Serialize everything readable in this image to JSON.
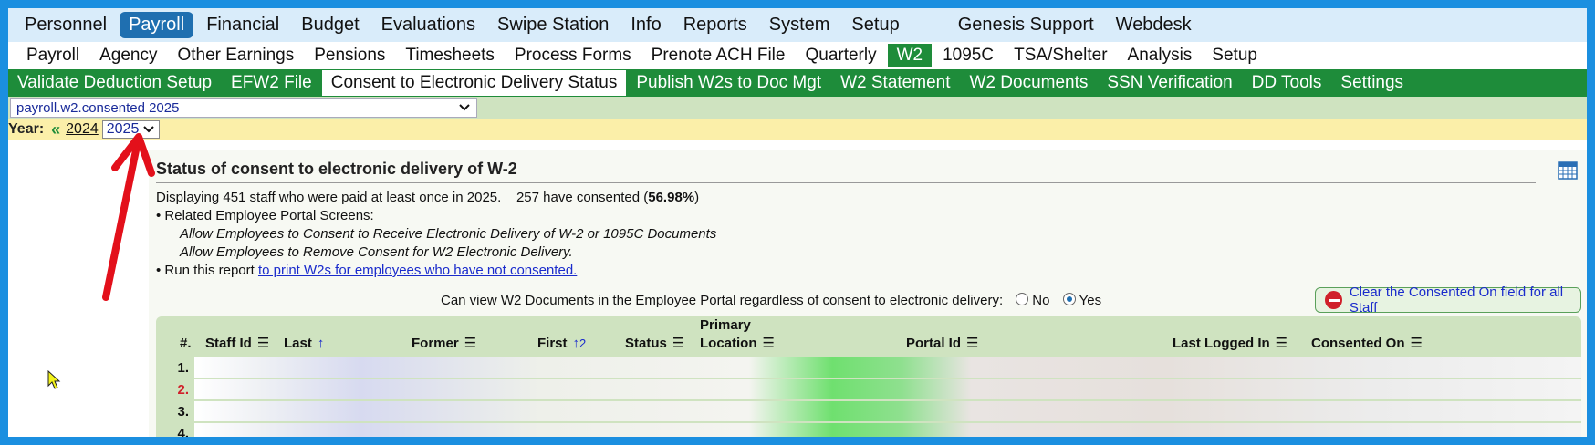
{
  "top_menu": [
    "Personnel",
    "Payroll",
    "Financial",
    "Budget",
    "Evaluations",
    "Swipe Station",
    "Info",
    "Reports",
    "System",
    "Setup",
    "Genesis Support",
    "Webdesk"
  ],
  "top_menu_active": "Payroll",
  "sub_menu": [
    "Payroll",
    "Agency",
    "Other Earnings",
    "Pensions",
    "Timesheets",
    "Process Forms",
    "Prenote ACH File",
    "Quarterly",
    "W2",
    "1095C",
    "TSA/Shelter",
    "Analysis",
    "Setup"
  ],
  "sub_menu_active": "W2",
  "w2_menu": [
    "Validate Deduction Setup",
    "EFW2 File",
    "Consent to Electronic Delivery Status",
    "Publish W2s to Doc Mgt",
    "W2 Statement",
    "W2 Documents",
    "SSN Verification",
    "DD Tools",
    "Settings"
  ],
  "w2_menu_active": "Consent to Electronic Delivery Status",
  "report_select": "payroll.w2.consented 2025",
  "year": {
    "label": "Year:",
    "prev": "2024",
    "selected": "2025"
  },
  "panel": {
    "title": "Status of consent to electronic delivery of W-2",
    "displaying": "Displaying 451 staff who were paid at least once in 2025.",
    "consented_prefix": "257 have consented (",
    "consented_pct": "56.98%",
    "consented_suffix": ")",
    "related": "• Related Employee Portal Screens:",
    "screen1": "Allow Employees to Consent to Receive Electronic Delivery of W-2 or 1095C Documents",
    "screen2": "Allow Employees to Remove Consent for W2 Electronic Delivery.",
    "run_prefix": "• Run this report ",
    "run_link": "to print W2s for employees who have not consented.",
    "view_text": "Can view W2 Documents in the Employee Portal regardless of consent to electronic delivery:",
    "no": "No",
    "yes": "Yes",
    "clear_button": "Clear the Consented On field for all Staff"
  },
  "table": {
    "headers": {
      "num": "#.",
      "staff_id": "Staff Id",
      "last": "Last",
      "former": "Former",
      "first": "First",
      "status": "Status",
      "primary": "Primary",
      "location": "Location",
      "portal_id": "Portal Id",
      "last_logged_in": "Last Logged In",
      "consented_on": "Consented On"
    },
    "sort_first_index": "2",
    "row_numbers": [
      "1.",
      "2.",
      "3.",
      "4."
    ]
  },
  "colors": {
    "accent_green": "#1e8c3a",
    "accent_blue": "#1f6fb0",
    "annotation_red": "#e3101b"
  }
}
